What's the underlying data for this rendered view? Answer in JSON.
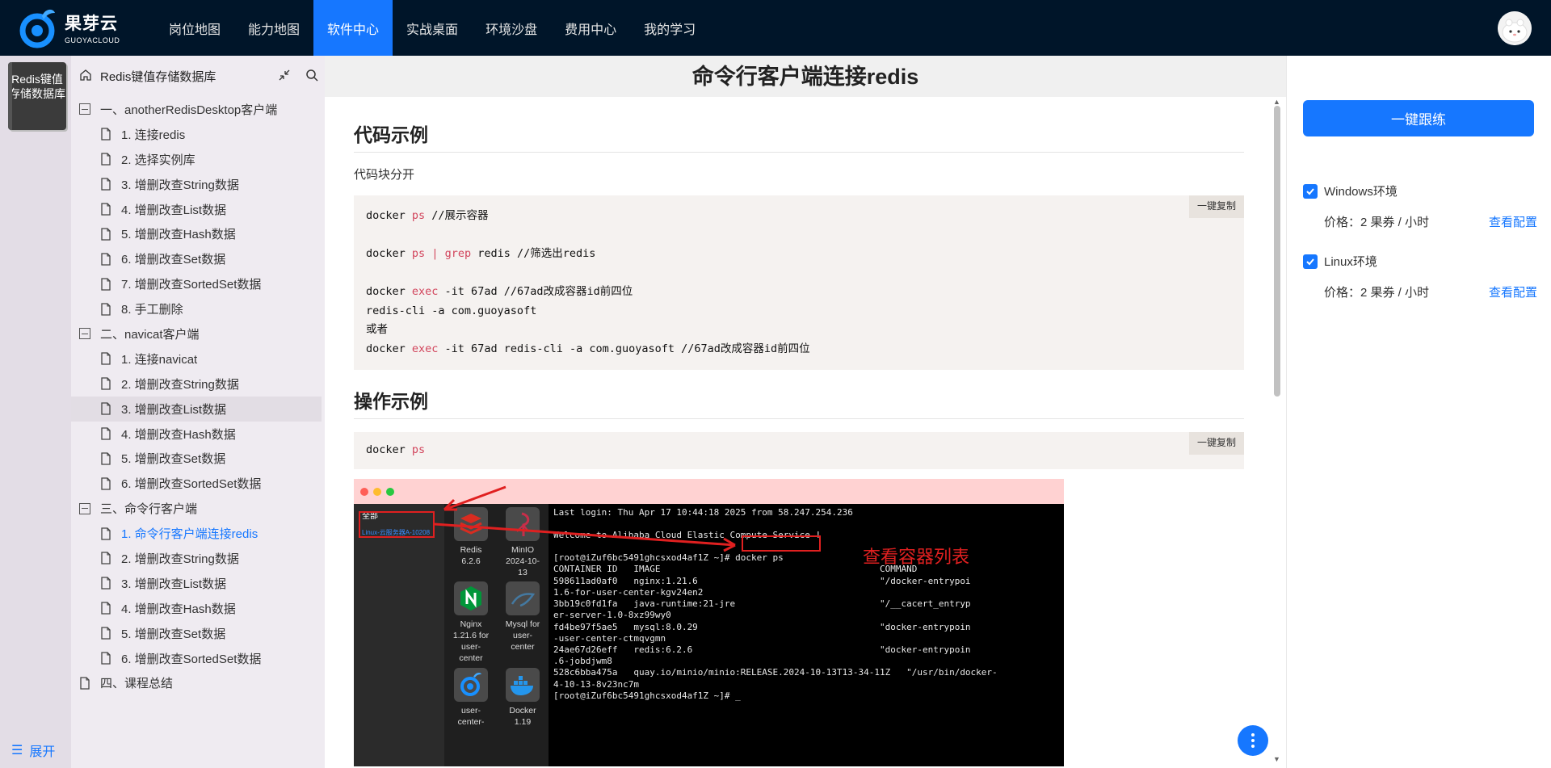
{
  "brand": {
    "name_cn": "果芽云",
    "name_en": "GUOYACLOUD"
  },
  "nav": [
    {
      "label": "岗位地图"
    },
    {
      "label": "能力地图"
    },
    {
      "label": "软件中心",
      "active": true
    },
    {
      "label": "实战桌面"
    },
    {
      "label": "环境沙盘"
    },
    {
      "label": "费用中心"
    },
    {
      "label": "我的学习"
    }
  ],
  "course_card": {
    "label": "Redis键值存储数据库"
  },
  "expand_label": "展开",
  "tree": {
    "title": "Redis键值存储数据库",
    "rows": [
      {
        "type": "section",
        "label": "一、anotherRedisDesktop客户端"
      },
      {
        "type": "item",
        "label": "1. 连接redis"
      },
      {
        "type": "item",
        "label": "2. 选择实例库"
      },
      {
        "type": "item",
        "label": "3. 增删改查String数据"
      },
      {
        "type": "item",
        "label": "4. 增删改查List数据"
      },
      {
        "type": "item",
        "label": "5. 增删改查Hash数据"
      },
      {
        "type": "item",
        "label": "6. 增删改查Set数据"
      },
      {
        "type": "item",
        "label": "7. 增删改查SortedSet数据"
      },
      {
        "type": "item",
        "label": "8. 手工删除"
      },
      {
        "type": "section",
        "label": "二、navicat客户端"
      },
      {
        "type": "item",
        "label": "1. 连接navicat"
      },
      {
        "type": "item",
        "label": "2. 增删改查String数据"
      },
      {
        "type": "item",
        "label": "3. 增删改查List数据",
        "selected": true
      },
      {
        "type": "item",
        "label": "4. 增删改查Hash数据"
      },
      {
        "type": "item",
        "label": "5. 增删改查Set数据"
      },
      {
        "type": "item",
        "label": "6. 增删改查SortedSet数据"
      },
      {
        "type": "section",
        "label": "三、命令行客户端"
      },
      {
        "type": "item",
        "label": "1. 命令行客户端连接redis",
        "active": true
      },
      {
        "type": "item",
        "label": "2. 增删改查String数据"
      },
      {
        "type": "item",
        "label": "3. 增删改查List数据"
      },
      {
        "type": "item",
        "label": "4. 增删改查Hash数据"
      },
      {
        "type": "item",
        "label": "5. 增删改查Set数据"
      },
      {
        "type": "item",
        "label": "6. 增删改查SortedSet数据"
      },
      {
        "type": "doc-section",
        "label": "四、课程总结"
      }
    ]
  },
  "main": {
    "title": "命令行客户端连接redis",
    "section1": {
      "heading": "代码示例",
      "intro": "代码块分开",
      "copy_label": "一键复制",
      "code_lines": [
        "docker ps  //展示容器",
        "",
        "docker ps | grep redis  //筛选出redis",
        "",
        "docker exec -it 67ad   //67ad改成容器id前四位",
        "redis-cli -a com.guoyasoft",
        "或者",
        "docker exec -it 67ad redis-cli -a com.guoyasoft //67ad改成容器id前四位"
      ]
    },
    "section2": {
      "heading": "操作示例",
      "copy_label": "一键复制",
      "code_line": "docker ps"
    },
    "screenshot": {
      "sidebar_header": "全部",
      "sidebar_item": "Linux-云服务器A-10208",
      "apps": [
        {
          "label": "Redis\n6.2.6",
          "icon": "redis-icon"
        },
        {
          "label": "MinIO\n2024-10-\n13",
          "icon": "minio-icon"
        },
        {
          "label": "Nginx\n1.21.6 for\nuser-\ncenter",
          "icon": "nginx-icon"
        },
        {
          "label": "Mysql for\nuser-\ncenter",
          "icon": "mysql-icon"
        },
        {
          "label": "user-\ncenter-",
          "icon": "user-center-icon"
        },
        {
          "label": "Docker\n1.19",
          "icon": "docker-icon"
        }
      ],
      "annotation": "查看容器列表",
      "terminal_lines": [
        "Last login: Thu Apr 17 10:44:18 2025 from 58.247.254.236",
        "",
        "Welcome to Alibaba Cloud Elastic Compute Service !",
        "",
        "[root@iZuf6bc5491ghcsxod4af1Z ~]# docker ps",
        "CONTAINER ID   IMAGE                                         COMMAND",
        "598611ad0af0   nginx:1.21.6                                  \"/docker-entrypoi",
        "1.6-for-user-center-kgv24en2",
        "3bb19c0fd1fa   java-runtime:21-jre                           \"/__cacert_entryp",
        "er-server-1.0-8xz99wy0",
        "fd4be97f5ae5   mysql:8.0.29                                  \"docker-entrypoin",
        "-user-center-ctmqvgmn",
        "24ae67d26eff   redis:6.2.6                                   \"docker-entrypoin",
        ".6-jobdjwm8",
        "528c6bba475a   quay.io/minio/minio:RELEASE.2024-10-13T13-34-11Z   \"/usr/bin/docker-",
        "4-10-13-8v23nc7m",
        "[root@iZuf6bc5491ghcsxod4af1Z ~]# _"
      ]
    }
  },
  "right_panel": {
    "practice_button": "一键跟练",
    "envs": [
      {
        "name": "Windows环境",
        "checked": true,
        "price": "价格：2 果券 / 小时",
        "link": "查看配置"
      },
      {
        "name": "Linux环境",
        "checked": true,
        "price": "价格：2 果券 / 小时",
        "link": "查看配置"
      }
    ]
  },
  "colors": {
    "topbar": "#001529",
    "accent": "#1677ff",
    "tree_bg": "#efebf1",
    "code_bg": "#f5f2f0",
    "keyword": "#d2455c",
    "annotation_red": "#e02020"
  }
}
